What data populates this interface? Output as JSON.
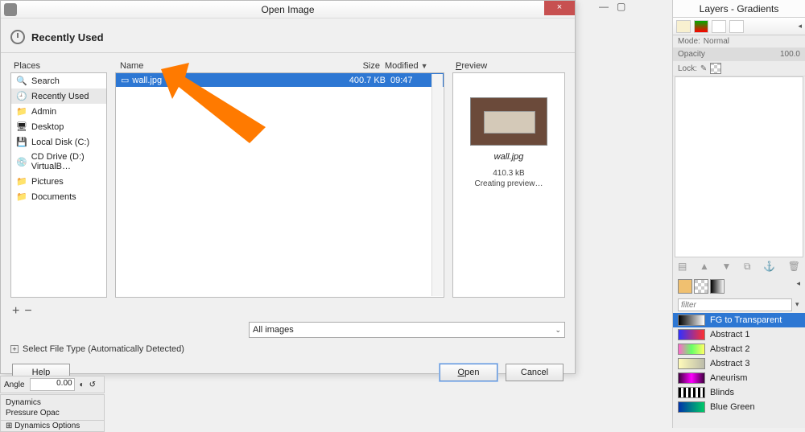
{
  "dialog": {
    "title": "Open Image",
    "recently_used": "Recently Used",
    "places_header": "Places",
    "name_header": "Name",
    "size_header": "Size",
    "modified_header": "Modified",
    "preview_header": "Preview",
    "filter": "All images",
    "select_filetype": "Select File Type (Automatically Detected)",
    "help": "Help",
    "open": "Open",
    "cancel": "Cancel",
    "close_x": "×",
    "places": [
      {
        "icon": "🔍",
        "label": "Search"
      },
      {
        "icon": "🕘",
        "label": "Recently Used",
        "selected": true
      },
      {
        "icon": "📁",
        "label": "Admin"
      },
      {
        "icon": "🖥",
        "label": "Desktop"
      },
      {
        "icon": "💾",
        "label": "Local Disk (C:)"
      },
      {
        "icon": "💿",
        "label": "CD Drive (D:) VirtualB…"
      },
      {
        "icon": "📁",
        "label": "Pictures"
      },
      {
        "icon": "📁",
        "label": "Documents"
      }
    ],
    "files": [
      {
        "name": "wall.jpg",
        "size": "400.7 KB",
        "modified": "09:47",
        "selected": true
      }
    ],
    "preview": {
      "name": "wall.jpg",
      "size": "410.3 kB",
      "status": "Creating preview…"
    },
    "plus": "+",
    "minus": "−",
    "expand": "+",
    "dropdown_arrow": "▾"
  },
  "right": {
    "title": "Layers - Gradients",
    "mode_label": "Mode:",
    "mode_value": "Normal",
    "opacity_label": "Opacity",
    "opacity_value": "100.0",
    "lock_label": "Lock:",
    "filter_placeholder": "filter",
    "gradients": [
      {
        "name": "FG to Transparent",
        "css": "linear-gradient(90deg,#000,#fff)",
        "selected": true
      },
      {
        "name": "Abstract 1",
        "css": "linear-gradient(90deg,#3030ff,#ff3030)"
      },
      {
        "name": "Abstract 2",
        "css": "linear-gradient(90deg,#ff66cc,#66ff66,#ffff66)"
      },
      {
        "name": "Abstract 3",
        "css": "linear-gradient(90deg,#fffbba,#bba)"
      },
      {
        "name": "Aneurism",
        "css": "linear-gradient(90deg,#400040,#ff00ff,#400040)"
      },
      {
        "name": "Blinds",
        "css": "repeating-linear-gradient(90deg,#000 0 3px,#fff 3px 6px)"
      },
      {
        "name": "Blue Green",
        "css": "linear-gradient(90deg,#0033aa,#00cc66)"
      }
    ]
  },
  "bg": {
    "angle_label": "Angle",
    "angle_value": "0.00",
    "dynamics": "Dynamics",
    "pressure": "Pressure Opac",
    "dyn_options": "Dynamics Options"
  },
  "win": {
    "min": "—",
    "max": "▢"
  }
}
